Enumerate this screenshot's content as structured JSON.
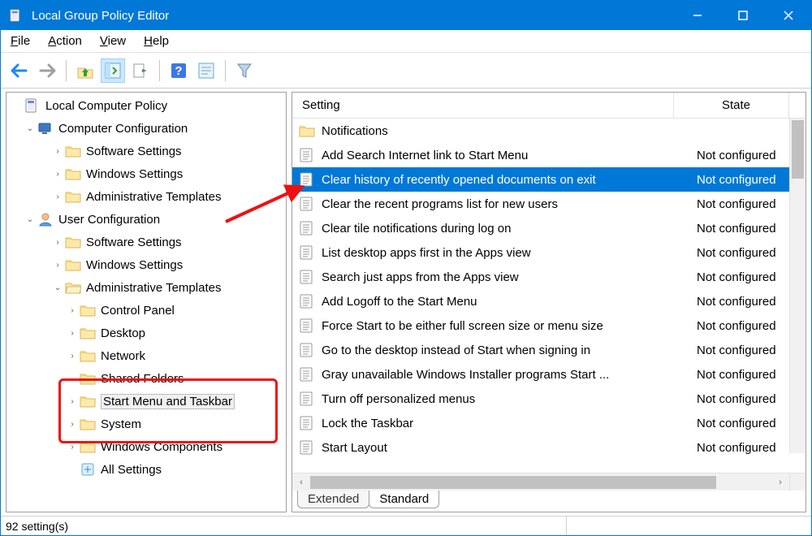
{
  "window": {
    "title": "Local Group Policy Editor"
  },
  "menu": {
    "file": "File",
    "action": "Action",
    "view": "View",
    "help": "Help"
  },
  "tree": {
    "root": "Local Computer Policy",
    "computer_config": "Computer Configuration",
    "cc_software": "Software Settings",
    "cc_windows": "Windows Settings",
    "cc_admin": "Administrative Templates",
    "user_config": "User Configuration",
    "uc_software": "Software Settings",
    "uc_windows": "Windows Settings",
    "uc_admin": "Administrative Templates",
    "control_panel": "Control Panel",
    "desktop": "Desktop",
    "network": "Network",
    "shared_folders": "Shared Folders",
    "start_menu": "Start Menu and Taskbar",
    "system": "System",
    "windows_components": "Windows Components",
    "all_settings": "All Settings"
  },
  "columns": {
    "setting": "Setting",
    "state": "State"
  },
  "settings": [
    {
      "name": "Notifications",
      "state": "",
      "folder": true
    },
    {
      "name": "Add Search Internet link to Start Menu",
      "state": "Not configured"
    },
    {
      "name": "Clear history of recently opened documents on exit",
      "state": "Not configured",
      "selected": true
    },
    {
      "name": "Clear the recent programs list for new users",
      "state": "Not configured"
    },
    {
      "name": "Clear tile notifications during log on",
      "state": "Not configured"
    },
    {
      "name": "List desktop apps first in the Apps view",
      "state": "Not configured"
    },
    {
      "name": "Search just apps from the Apps view",
      "state": "Not configured"
    },
    {
      "name": "Add Logoff to the Start Menu",
      "state": "Not configured"
    },
    {
      "name": "Force Start to be either full screen size or menu size",
      "state": "Not configured"
    },
    {
      "name": "Go to the desktop instead of Start when signing in",
      "state": "Not configured"
    },
    {
      "name": "Gray unavailable Windows Installer programs Start ...",
      "state": "Not configured"
    },
    {
      "name": "Turn off personalized menus",
      "state": "Not configured"
    },
    {
      "name": "Lock the Taskbar",
      "state": "Not configured"
    },
    {
      "name": "Start Layout",
      "state": "Not configured"
    }
  ],
  "tabs": {
    "extended": "Extended",
    "standard": "Standard"
  },
  "status": {
    "count": "92 setting(s)"
  }
}
